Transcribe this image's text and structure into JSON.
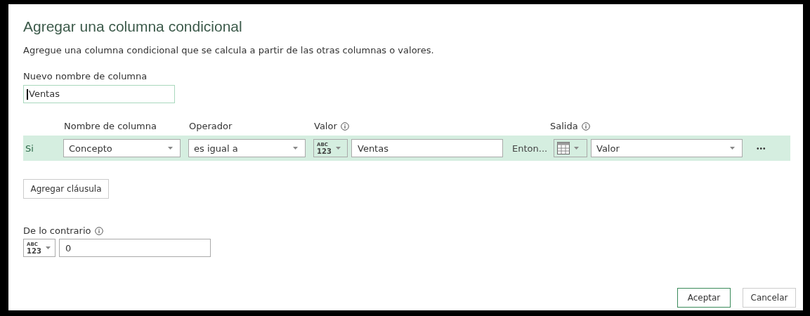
{
  "dialog": {
    "title": "Agregar una columna condicional",
    "description": "Agregue una columna condicional que se calcula a partir de las otras columnas o valores."
  },
  "new_column": {
    "label": "Nuevo nombre de columna",
    "value": "Ventas"
  },
  "headers": [
    {
      "label": "Nombre de columna",
      "info": false
    },
    {
      "label": "Operador",
      "info": false
    },
    {
      "label": "Valor",
      "info": true
    },
    {
      "label": "Salida",
      "info": true
    }
  ],
  "rule": {
    "if_label": "Si",
    "column": "Concepto",
    "operator": "es igual a",
    "value_type": [
      "ABC",
      "123"
    ],
    "value": "Ventas",
    "then_label": "Enton...",
    "output": "Valor",
    "more": "•••"
  },
  "add_clause": "Agregar cláusula",
  "otherwise": {
    "label": "De lo contrario",
    "value_type": [
      "ABC",
      "123"
    ],
    "value": "0"
  },
  "buttons": [
    {
      "label": "Aceptar",
      "primary": true
    },
    {
      "label": "Cancelar",
      "primary": false
    }
  ]
}
